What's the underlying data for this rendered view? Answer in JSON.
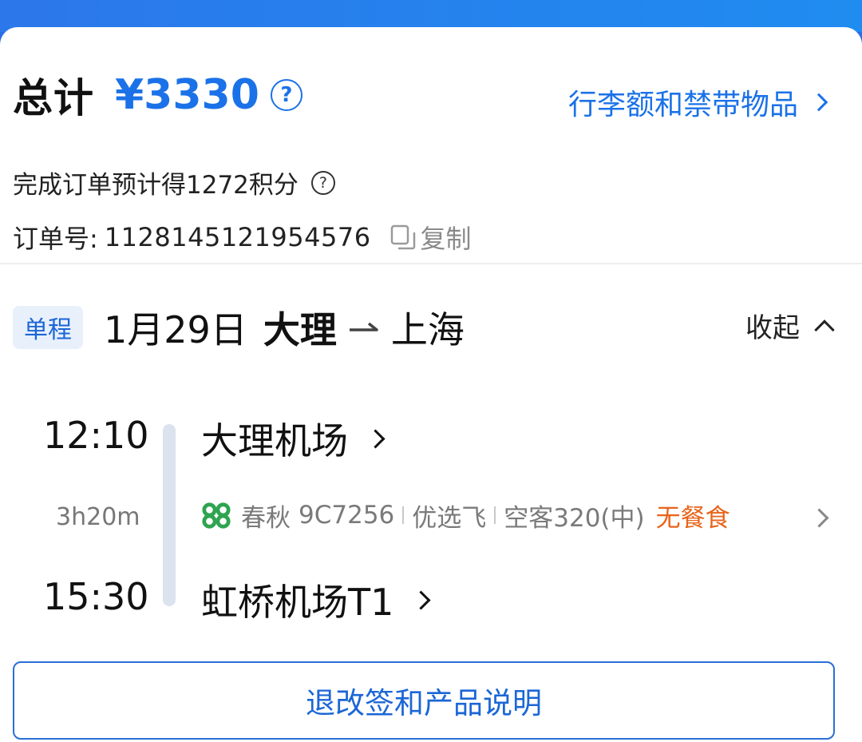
{
  "summary": {
    "total_label": "总计",
    "total_price": "¥3330",
    "help_glyph": "?",
    "baggage_link": "行李额和禁带物品",
    "points_text": "完成订单预计得1272积分",
    "order_label": "订单号:",
    "order_number": "1128145121954576",
    "copy_label": "复制"
  },
  "trip": {
    "tag": "单程",
    "date": "1月29日",
    "from_city": "大理",
    "to_city": "上海",
    "collapse_label": "收起"
  },
  "flight": {
    "dep_time": "12:10",
    "arr_time": "15:30",
    "duration": "3h20m",
    "dep_airport": "大理机场",
    "arr_airport": "虹桥机场T1",
    "airline_name": "春秋",
    "flight_number": "9C7256",
    "service_tag": "优选飞",
    "aircraft": "空客320(中)",
    "meal": "无餐食"
  },
  "policy_button": "退改签和产品说明",
  "colors": {
    "accent": "#1b72e8",
    "meal_orange": "#e8641b",
    "airline_green": "#2ea44f",
    "header_blue": "#2c77ea"
  },
  "icons": {
    "help": "question-circle-icon",
    "copy": "copy-icon",
    "arrow": "right-arrow-icon",
    "collapse": "chevron-up-icon",
    "airline": "spring-airlines-logo-icon",
    "chevron": "chevron-right-icon"
  }
}
